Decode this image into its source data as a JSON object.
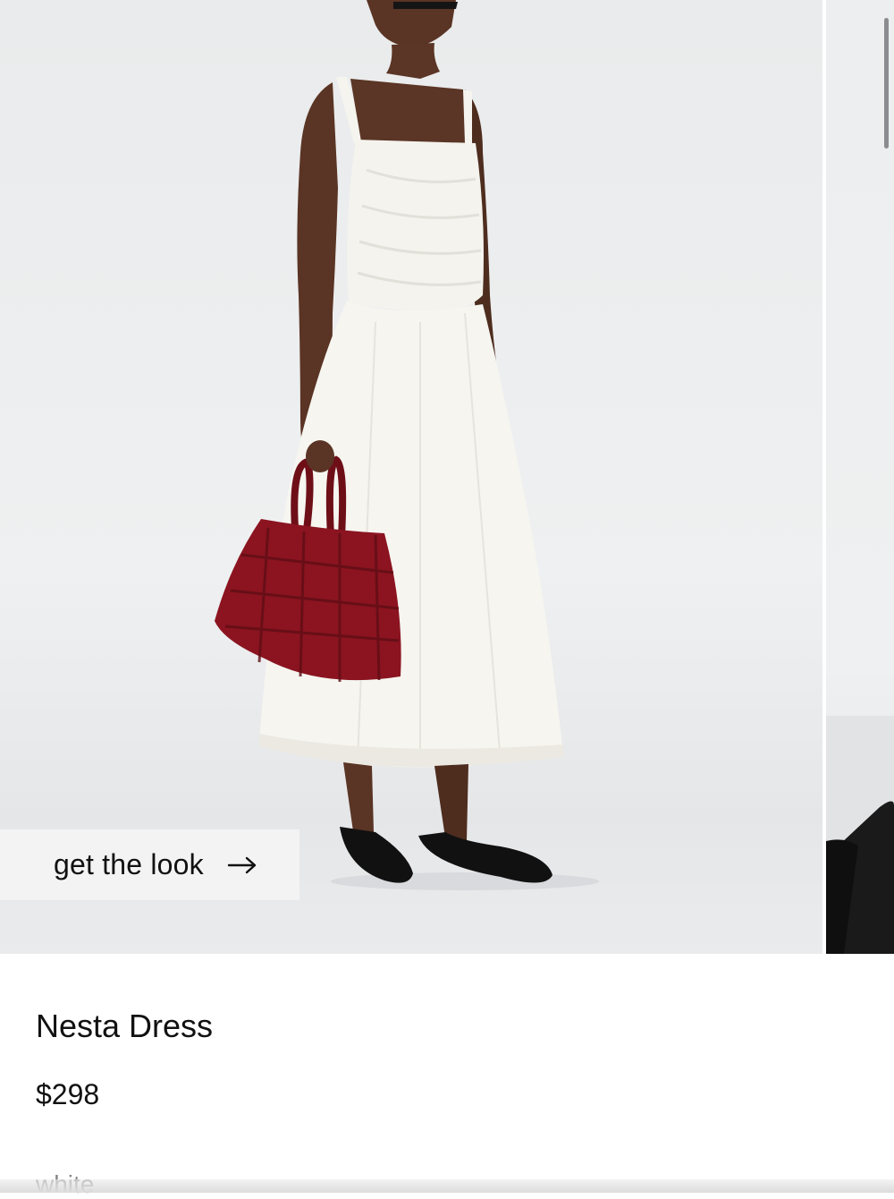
{
  "gallery": {
    "look_button": {
      "label": "get the look",
      "icon": "arrow-right-icon"
    },
    "colors": {
      "backdrop": "#eceeef",
      "dress": "#f5f4ef",
      "bag": "#8b1420",
      "shoes": "#111111",
      "skin": "#5a3424"
    }
  },
  "product": {
    "name": "Nesta Dress",
    "price": "$298",
    "partial_label": "white"
  }
}
